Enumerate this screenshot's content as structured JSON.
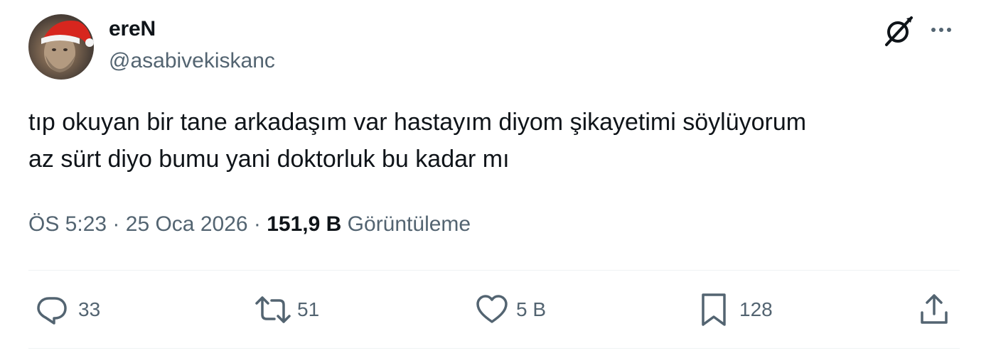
{
  "author": {
    "display_name": "ereN",
    "handle": "@asabivekiskanc"
  },
  "icons": {
    "header": [
      "grok-icon",
      "more-icon"
    ],
    "actions": [
      "reply-icon",
      "retweet-icon",
      "like-icon",
      "bookmark-icon",
      "share-icon"
    ]
  },
  "tweet": {
    "text": "tıp okuyan bir tane arkadaşım var hastayım diyom şikayetimi söylüyorum\naz sürt diyo bumu yani doktorluk bu kadar mı",
    "time": "ÖS 5:23",
    "separator": "·",
    "date": "25 Oca 2026",
    "views_count": "151,9 B",
    "views_label": "Görüntüleme"
  },
  "actions": {
    "replies": "33",
    "retweets": "51",
    "likes": "5 B",
    "bookmarks": "128"
  },
  "colors": {
    "text_primary": "#0f1419",
    "text_secondary": "#536471",
    "divider": "#eff3f4",
    "santa_hat_red": "#d7261e"
  }
}
